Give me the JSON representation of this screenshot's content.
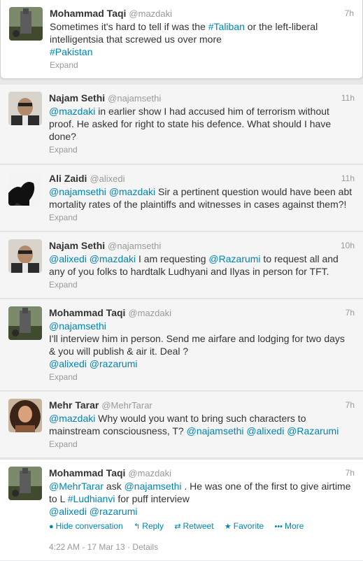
{
  "tweets": [
    {
      "name": "Mohammad Taqi",
      "handle": "@mazdaki",
      "time": "7h",
      "lines": [
        [
          {
            "t": "Sometimes it's hard to tell if was the "
          },
          {
            "t": "#Taliban",
            "l": 1
          },
          {
            "t": " or the left-liberal"
          }
        ],
        [
          {
            "t": "intelligentsia that screwed us over more"
          }
        ],
        [
          {
            "t": "#Pakistan",
            "l": 1
          }
        ]
      ],
      "expand": "Expand"
    },
    {
      "name": "Najam Sethi",
      "handle": "@najamsethi",
      "time": "11h",
      "lines": [
        [
          {
            "t": "@mazdaki",
            "l": 1
          },
          {
            "t": " in earlier show I had accused him of terrorism without"
          }
        ],
        [
          {
            "t": "proof. He asked for right to state his defence. What should I have"
          }
        ],
        [
          {
            "t": "done?"
          }
        ]
      ],
      "expand": "Expand"
    },
    {
      "name": "Ali Zaidi",
      "handle": "@alixedi",
      "time": "11h",
      "lines": [
        [
          {
            "t": "@najamsethi",
            "l": 1
          },
          {
            "t": " "
          },
          {
            "t": "@mazdaki",
            "l": 1
          },
          {
            "t": " Sir a pertinent question would have been abt"
          }
        ],
        [
          {
            "t": "mortality rates of the plaintiffs and witnesses in cases against them?!"
          }
        ]
      ],
      "expand": "Expand"
    },
    {
      "name": "Najam Sethi",
      "handle": "@najamsethi",
      "time": "10h",
      "lines": [
        [
          {
            "t": "@alixedi",
            "l": 1
          },
          {
            "t": " "
          },
          {
            "t": "@mazdaki",
            "l": 1
          },
          {
            "t": " I am requesting "
          },
          {
            "t": "@Razarumi",
            "l": 1
          },
          {
            "t": " to request all and"
          }
        ],
        [
          {
            "t": "any of you folks to hardtalk Ludhyani and Ilyas in person for TFT."
          }
        ]
      ],
      "expand": "Expand"
    },
    {
      "name": "Mohammad Taqi",
      "handle": "@mazdaki",
      "time": "7h",
      "lines": [
        [
          {
            "t": "@najamsethi",
            "l": 1
          }
        ],
        [
          {
            "t": "I'll interview him in person. Send me airfare and lodging for two days"
          }
        ],
        [
          {
            "t": "& you will publish & air it. Deal ?"
          }
        ],
        [
          {
            "t": "@alixedi",
            "l": 1
          },
          {
            "t": " "
          },
          {
            "t": "@razarumi",
            "l": 1
          }
        ]
      ],
      "expand": "Expand"
    },
    {
      "name": "Mehr Tarar",
      "handle": "@MehrTarar",
      "time": "7h",
      "lines": [
        [
          {
            "t": "@mazdaki",
            "l": 1
          },
          {
            "t": " Why would you want to bring such characters to"
          }
        ],
        [
          {
            "t": "mainstream consciousness, T? "
          },
          {
            "t": "@najamsethi",
            "l": 1
          },
          {
            "t": " "
          },
          {
            "t": "@alixedi",
            "l": 1
          },
          {
            "t": " "
          },
          {
            "t": "@Razarumi",
            "l": 1
          }
        ]
      ],
      "expand": "Expand"
    },
    {
      "name": "Mohammad Taqi",
      "handle": "@mazdaki",
      "time": "7h",
      "lines": [
        [
          {
            "t": "@MehrTarar",
            "l": 1
          },
          {
            "t": " ask "
          },
          {
            "t": "@najamsethi",
            "l": 1
          },
          {
            "t": " . He was one of the first to give airtime"
          }
        ],
        [
          {
            "t": "to L "
          },
          {
            "t": "#Ludhianvi",
            "l": 1
          },
          {
            "t": " for puff interview"
          }
        ],
        [
          {
            "t": "@alixedi",
            "l": 1
          },
          {
            "t": " "
          },
          {
            "t": "@razarumi",
            "l": 1
          }
        ]
      ]
    }
  ],
  "actions": {
    "hide": "Hide conversation",
    "reply": "Reply",
    "retweet": "Retweet",
    "favorite": "Favorite",
    "more": "More"
  },
  "meta": {
    "timestamp": "4:22 AM - 17 Mar 13",
    "sep": " · ",
    "details": "Details"
  },
  "colors": {
    "link": "#0084b4",
    "muted": "#999999",
    "text": "#333333"
  }
}
